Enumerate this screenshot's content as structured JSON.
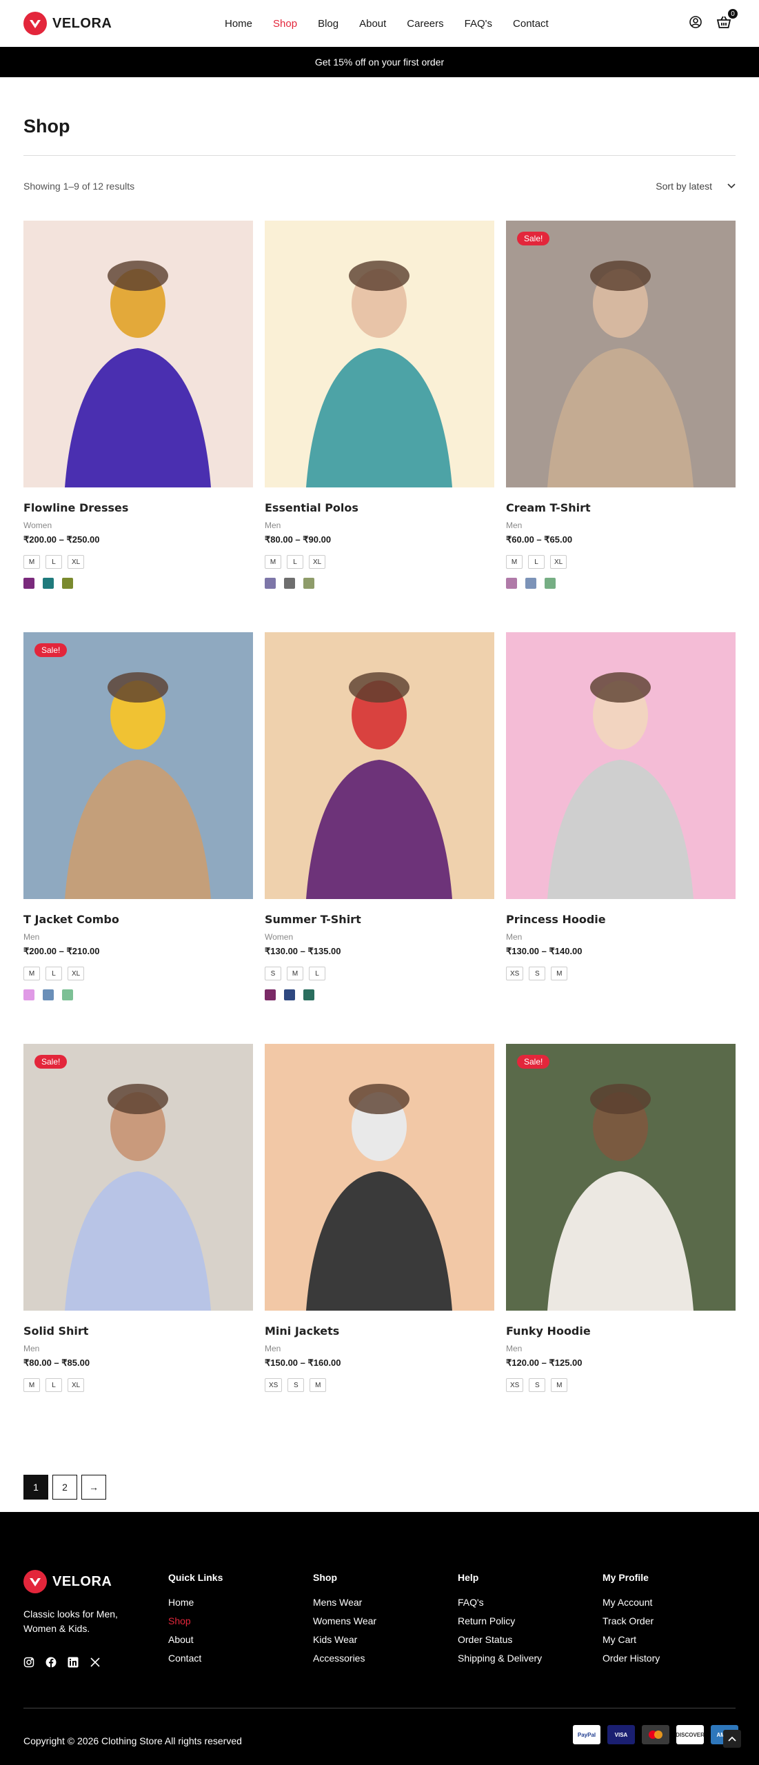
{
  "brand": {
    "name": "VELORA",
    "accent": "#e3263b"
  },
  "nav": {
    "items": [
      {
        "label": "Home",
        "active": false
      },
      {
        "label": "Shop",
        "active": true
      },
      {
        "label": "Blog",
        "active": false
      },
      {
        "label": "About",
        "active": false
      },
      {
        "label": "Careers",
        "active": false
      },
      {
        "label": "FAQ's",
        "active": false
      },
      {
        "label": "Contact",
        "active": false
      }
    ]
  },
  "header": {
    "cart_count": "0",
    "icons": [
      "user-icon",
      "basket-icon"
    ]
  },
  "promo": "Get 15% off on your first order",
  "page": {
    "title": "Shop",
    "results": "Showing 1–9 of 12 results",
    "sort": "Sort by latest"
  },
  "products": [
    {
      "title": "Flowline Dresses",
      "category": "Women",
      "price": "₹200.00 – ₹250.00",
      "sale": false,
      "sizes": [
        "M",
        "L",
        "XL"
      ],
      "swatches": [
        "#7a2a7c",
        "#1f7a7c",
        "#7a8a2e"
      ],
      "image": {
        "bg": "#f3e3dc",
        "fig": "#4a2fb0",
        "accent": "#e3a93a"
      }
    },
    {
      "title": "Essential Polos",
      "category": "Men",
      "price": "₹80.00 – ₹90.00",
      "sale": false,
      "sizes": [
        "M",
        "L",
        "XL"
      ],
      "swatches": [
        "#7d76a8",
        "#6e6e6e",
        "#8e9c6a"
      ],
      "image": {
        "bg": "#faf0d6",
        "fig": "#4da3a6",
        "accent": "#e8c4a8"
      }
    },
    {
      "title": "Cream T-Shirt",
      "category": "Men",
      "price": "₹60.00 – ₹65.00",
      "sale": true,
      "sizes": [
        "M",
        "L",
        "XL"
      ],
      "swatches": [
        "#b07aa8",
        "#7c93b8",
        "#76ae84"
      ],
      "image": {
        "bg": "#a79a92",
        "fig": "#c4ab92",
        "accent": "#d6b8a0"
      }
    },
    {
      "title": "T Jacket Combo",
      "category": "Men",
      "price": "₹200.00 – ₹210.00",
      "sale": true,
      "sizes": [
        "M",
        "L",
        "XL"
      ],
      "swatches": [
        "#e09ae6",
        "#6a8fb8",
        "#7cc095"
      ],
      "image": {
        "bg": "#8fa9c0",
        "fig": "#c49f7a",
        "accent": "#f0c233"
      }
    },
    {
      "title": "Summer T-Shirt",
      "category": "Women",
      "price": "₹130.00 – ₹135.00",
      "sale": false,
      "sizes": [
        "S",
        "M",
        "L"
      ],
      "swatches": [
        "#7a2a66",
        "#2e4880",
        "#2a6e5e"
      ],
      "image": {
        "bg": "#efd1ad",
        "fig": "#6d3379",
        "accent": "#d9423f"
      }
    },
    {
      "title": "Princess Hoodie",
      "category": "Men",
      "price": "₹130.00 – ₹140.00",
      "sale": false,
      "sizes": [
        "XS",
        "S",
        "M"
      ],
      "swatches": [],
      "image": {
        "bg": "#f4bcd6",
        "fig": "#cfcfcf",
        "accent": "#f2d4c0"
      }
    },
    {
      "title": "Solid Shirt",
      "category": "Men",
      "price": "₹80.00 – ₹85.00",
      "sale": true,
      "sizes": [
        "M",
        "L",
        "XL"
      ],
      "swatches": [],
      "image": {
        "bg": "#d8d2ca",
        "fig": "#b8c4e6",
        "accent": "#c99a7c"
      }
    },
    {
      "title": "Mini Jackets",
      "category": "Men",
      "price": "₹150.00 – ₹160.00",
      "sale": false,
      "sizes": [
        "XS",
        "S",
        "M"
      ],
      "swatches": [],
      "image": {
        "bg": "#f2c8a6",
        "fig": "#3a3a3a",
        "accent": "#e9e9e9"
      }
    },
    {
      "title": "Funky Hoodie",
      "category": "Men",
      "price": "₹120.00 – ₹125.00",
      "sale": true,
      "sizes": [
        "XS",
        "S",
        "M"
      ],
      "swatches": [],
      "image": {
        "bg": "#5a6a4a",
        "fig": "#ece8e2",
        "accent": "#7a5a40"
      }
    }
  ],
  "sale_label": "Sale!",
  "pagination": {
    "pages": [
      "1",
      "2"
    ],
    "next": "→",
    "current": "1"
  },
  "footer": {
    "tagline": "Classic looks for Men, Women & Kids.",
    "social_icons": [
      "instagram-icon",
      "facebook-icon",
      "linkedin-icon",
      "x-icon"
    ],
    "columns": [
      {
        "title": "Quick Links",
        "links": [
          {
            "label": "Home",
            "active": false
          },
          {
            "label": "Shop",
            "active": true
          },
          {
            "label": "About",
            "active": false
          },
          {
            "label": "Contact",
            "active": false
          }
        ]
      },
      {
        "title": "Shop",
        "links": [
          {
            "label": "Mens Wear",
            "active": false
          },
          {
            "label": "Womens Wear",
            "active": false
          },
          {
            "label": "Kids Wear",
            "active": false
          },
          {
            "label": "Accessories",
            "active": false
          }
        ]
      },
      {
        "title": "Help",
        "links": [
          {
            "label": "FAQ's",
            "active": false
          },
          {
            "label": "Return Policy",
            "active": false
          },
          {
            "label": "Order Status",
            "active": false
          },
          {
            "label": "Shipping & Delivery",
            "active": false
          }
        ]
      },
      {
        "title": "My Profile",
        "links": [
          {
            "label": "My Account",
            "active": false
          },
          {
            "label": "Track Order",
            "active": false
          },
          {
            "label": "My Cart",
            "active": false
          },
          {
            "label": "Order History",
            "active": false
          }
        ]
      }
    ],
    "copyright": "Copyright © 2026 Clothing Store All rights reserved",
    "payments": [
      {
        "label": "PayPal",
        "bg": "#ffffff",
        "fg": "#1f3c8f"
      },
      {
        "label": "VISA",
        "bg": "#1a1f71",
        "fg": "#ffffff"
      },
      {
        "label": "",
        "bg": "#3a3a3a",
        "fg": "#ffffff"
      },
      {
        "label": "DISCOVER",
        "bg": "#ffffff",
        "fg": "#333333"
      },
      {
        "label": "AMEX",
        "bg": "#2e77bb",
        "fg": "#ffffff"
      }
    ]
  }
}
